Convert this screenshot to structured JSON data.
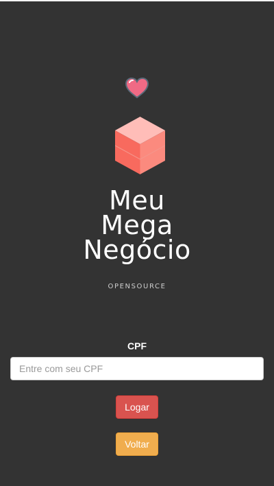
{
  "colors": {
    "background": "#333333",
    "heart": "#f06a85",
    "cube_top": "#ffbdb8",
    "cube_left": "#f86a5e",
    "cube_right": "#fb8a7e",
    "login_button": "#d9534f",
    "back_button": "#f0ad4e"
  },
  "logo": {
    "heart_icon": "heart-icon",
    "cube_icon": "cube-icon",
    "lines": [
      "Meu",
      "Mega",
      "Negócio"
    ],
    "subtitle": "OPENSOURCE"
  },
  "form": {
    "cpf_label": "CPF",
    "cpf_placeholder": "Entre com seu CPF",
    "cpf_value": "",
    "login_label": "Logar",
    "back_label": "Voltar"
  }
}
